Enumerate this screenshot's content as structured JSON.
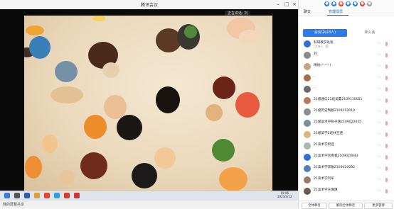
{
  "window": {
    "title": "腾讯会议"
  },
  "speaker_tag": "正在讲话: 刘",
  "panel": {
    "tab_chat": "聊天",
    "tab_manage": "管理成员",
    "seg_in_meeting": "会议中(43人)",
    "seg_not_joined": "未入会",
    "members": [
      {
        "name": "科研教学处张",
        "sub": "(主持人, 我)",
        "avatar": "#2f6fd6"
      },
      {
        "name": "刘",
        "sub": "",
        "avatar": "#8a8a8a"
      },
      {
        "name": "晴怡(^~^)",
        "sub": "",
        "avatar": "#c9a27e"
      },
      {
        "name": "..",
        "sub": "",
        "avatar": "#a86c49"
      },
      {
        "name": "..",
        "sub": "",
        "avatar": "#6c6c6c"
      },
      {
        "name": "21级通信21班吴蕾2109110051",
        "sub": "",
        "avatar": "#b47c5a"
      },
      {
        "name": "21级历史陶鹏2109110010",
        "sub": "",
        "avatar": "#8d8d8d"
      },
      {
        "name": "21级美术学张子涵2109020055",
        "sub": "",
        "avatar": "#7a8e9e"
      },
      {
        "name": "21级美学2班林玉涵",
        "sub": "",
        "avatar": "#e0b37a"
      },
      {
        "name": "21美术学阿佳",
        "sub": "",
        "avatar": "#b2b2b2"
      },
      {
        "name": "21美术学吕青春2109020043",
        "sub": "",
        "avatar": "#2f6fd6"
      },
      {
        "name": "21美术学李敏2109020092",
        "sub": "",
        "avatar": "#4f7fb8"
      },
      {
        "name": "21美术学刘军",
        "sub": "",
        "avatar": "#9b7b66"
      },
      {
        "name": "21美术学王琳琳",
        "sub": "",
        "avatar": "#6f5a4c"
      }
    ],
    "bottom_buttons": [
      "全体静音",
      "解除全体静音",
      "更多管理"
    ]
  },
  "taskbar": {
    "time": "19:06",
    "date": "2023/4/12"
  },
  "bottom_strip": "我的屏幕共享"
}
